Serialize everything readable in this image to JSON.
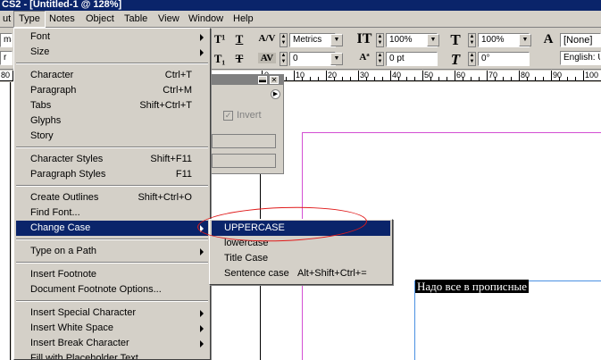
{
  "window": {
    "title": "CS2 - [Untitled-1 @ 128%]"
  },
  "menubar": [
    "ut",
    "Type",
    "Notes",
    "Object",
    "Table",
    "View",
    "Window",
    "Help"
  ],
  "control_panel": {
    "font_style_value": "Metrics",
    "tracking_value": "0",
    "vertical_scale": "100%",
    "horizontal_scale": "100%",
    "baseline_shift": "0 pt",
    "skew": "0°",
    "char_style": "[None]",
    "language": "English: U",
    "left_field_1": "ma",
    "left_field_2": "r"
  },
  "ruler": {
    "left_label": "80",
    "ticks": [
      "0",
      "10",
      "20",
      "30",
      "40",
      "50",
      "60",
      "70",
      "80",
      "90",
      "100"
    ]
  },
  "type_menu": {
    "items": [
      {
        "label": "Font",
        "shortcut": "",
        "submenu": true
      },
      {
        "label": "Size",
        "shortcut": "",
        "submenu": true
      },
      {
        "label": "Character",
        "shortcut": "Ctrl+T",
        "submenu": false
      },
      {
        "label": "Paragraph",
        "shortcut": "Ctrl+M",
        "submenu": false
      },
      {
        "label": "Tabs",
        "shortcut": "Shift+Ctrl+T",
        "submenu": false
      },
      {
        "label": "Glyphs",
        "shortcut": "",
        "submenu": false
      },
      {
        "label": "Story",
        "shortcut": "",
        "submenu": false
      },
      {
        "label": "Character Styles",
        "shortcut": "Shift+F11",
        "submenu": false
      },
      {
        "label": "Paragraph Styles",
        "shortcut": "F11",
        "submenu": false
      },
      {
        "label": "Create Outlines",
        "shortcut": "Shift+Ctrl+O",
        "submenu": false
      },
      {
        "label": "Find Font...",
        "shortcut": "",
        "submenu": false
      },
      {
        "label": "Change Case",
        "shortcut": "",
        "submenu": true
      },
      {
        "label": "Type on a Path",
        "shortcut": "",
        "submenu": true
      },
      {
        "label": "Insert Footnote",
        "shortcut": "",
        "submenu": false
      },
      {
        "label": "Document Footnote Options...",
        "shortcut": "",
        "submenu": false
      },
      {
        "label": "Insert Special Character",
        "shortcut": "",
        "submenu": true
      },
      {
        "label": "Insert White Space",
        "shortcut": "",
        "submenu": true
      },
      {
        "label": "Insert Break Character",
        "shortcut": "",
        "submenu": true
      },
      {
        "label": "Fill with Placeholder Text",
        "shortcut": "",
        "submenu": false
      }
    ]
  },
  "change_case_submenu": {
    "items": [
      {
        "label": "UPPERCASE",
        "shortcut": ""
      },
      {
        "label": "lowercase",
        "shortcut": ""
      },
      {
        "label": "Title Case",
        "shortcut": ""
      },
      {
        "label": "Sentence case",
        "shortcut": "Alt+Shift+Ctrl+="
      }
    ]
  },
  "palette": {
    "invert_label": "Invert"
  },
  "canvas": {
    "selected_text": "Надо все в прописные"
  },
  "colors": {
    "highlight": "#0a246a",
    "margin_guide": "#d34fd3",
    "frame_edge": "#4a90e2",
    "annotation": "#e01a1a"
  }
}
